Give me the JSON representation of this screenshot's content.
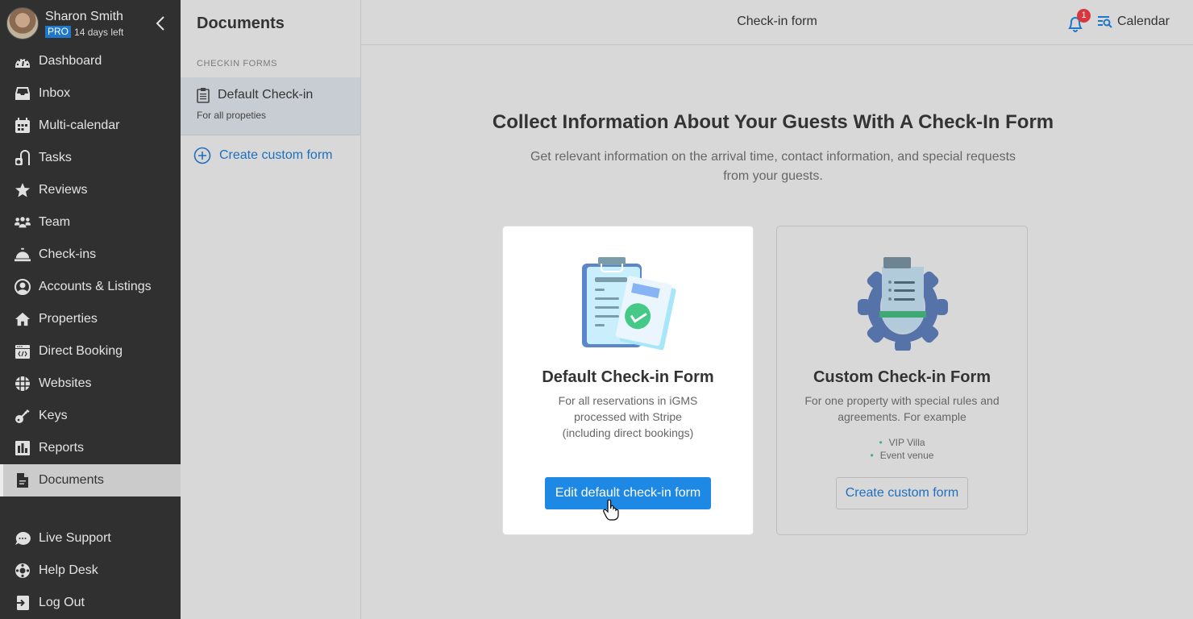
{
  "user": {
    "name": "Sharon Smith",
    "plan_badge": "PRO",
    "trial_status": "14 days left"
  },
  "nav": {
    "items": [
      {
        "label": "Dashboard",
        "icon": "dashboard-icon"
      },
      {
        "label": "Inbox",
        "icon": "inbox-icon"
      },
      {
        "label": "Multi-calendar",
        "icon": "calendar-icon"
      },
      {
        "label": "Tasks",
        "icon": "vacuum-icon"
      },
      {
        "label": "Reviews",
        "icon": "star-icon"
      },
      {
        "label": "Team",
        "icon": "users-icon"
      },
      {
        "label": "Check-ins",
        "icon": "concierge-bell-icon"
      },
      {
        "label": "Accounts & Listings",
        "icon": "user-circle-icon"
      },
      {
        "label": "Properties",
        "icon": "home-icon"
      },
      {
        "label": "Direct Booking",
        "icon": "code-window-icon"
      },
      {
        "label": "Websites",
        "icon": "globe-icon"
      },
      {
        "label": "Keys",
        "icon": "key-icon"
      },
      {
        "label": "Reports",
        "icon": "bar-chart-icon"
      },
      {
        "label": "Documents",
        "icon": "document-icon",
        "active": true
      }
    ],
    "bottom_items": [
      {
        "label": "Live Support",
        "icon": "chat-icon"
      },
      {
        "label": "Help Desk",
        "icon": "lifebuoy-icon"
      },
      {
        "label": "Log Out",
        "icon": "logout-icon"
      }
    ]
  },
  "panel": {
    "title": "Documents",
    "section_label": "CHECKIN FORMS",
    "items": [
      {
        "label": "Default Check-in",
        "sublabel": "For all propeties",
        "icon": "clipboard-icon",
        "selected": true
      }
    ],
    "create_label": "Create custom form"
  },
  "topbar": {
    "title": "Check-in form",
    "notification_count": "1",
    "calendar_label": "Calendar"
  },
  "hero": {
    "title": "Collect Information About Your Guests With A Check-In Form",
    "subtitle": "Get relevant information on the arrival time, contact information, and special requests from your guests."
  },
  "cards": {
    "default": {
      "title": "Default Check-in Form",
      "description": "For all reservations in iGMS processed with Stripe (including direct bookings)",
      "desc_lines": [
        "For all reservations in iGMS",
        "processed with Stripe",
        "(including direct bookings)"
      ],
      "button": "Edit default check-in form"
    },
    "custom": {
      "title": "Custom Check-in Form",
      "desc_lines": [
        "For one property with special rules and",
        "agreements. For example"
      ],
      "examples": [
        "VIP Villa",
        "Event venue"
      ],
      "button": "Create custom form"
    }
  },
  "colors": {
    "accent": "#1e88e5",
    "link": "#1f6fbf",
    "nav_bg": "#303030",
    "badge": "#d9363e",
    "bullet": "#3fb37a"
  }
}
